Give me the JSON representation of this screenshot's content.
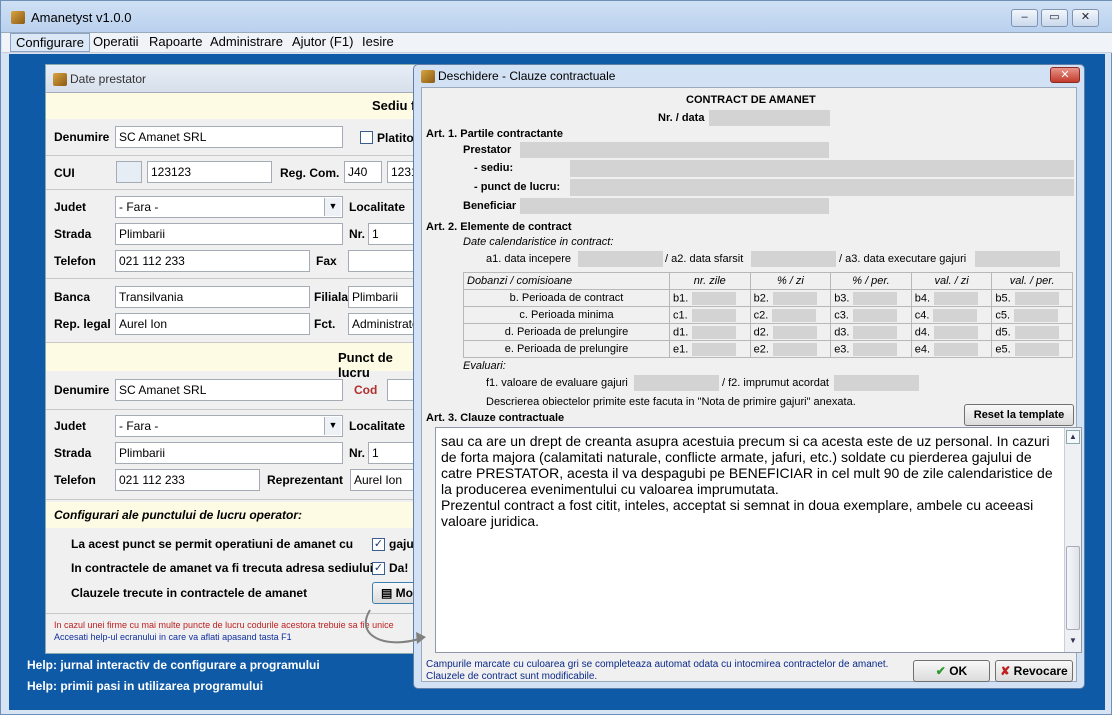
{
  "app": {
    "title": "Amanetyst v1.0.0",
    "controls": {
      "minimize": "‒",
      "maximize": "▭",
      "close": "✕"
    }
  },
  "menu": [
    "Configurare",
    "Operatii",
    "Rapoarte",
    "Administrare",
    "Ajutor (F1)",
    "Iesire"
  ],
  "help": [
    "Help: jurnal interactiv de configurare a programului",
    "Help: primii pasi in utilizarea programului"
  ],
  "prestator": {
    "title": "Date prestator",
    "sediu_header": "Sediu f",
    "denumire_label": "Denumire",
    "denumire": "SC Amanet SRL",
    "platitor_label": "Platitor",
    "cui_label": "CUI",
    "cui": "123123",
    "regcom_label": "Reg. Com.",
    "regcom_a": "J40",
    "regcom_b": "1231",
    "judet_label": "Judet",
    "judet": "- Fara -",
    "localitate_label": "Localitate",
    "strada_label": "Strada",
    "strada": "Plimbarii",
    "nr_label": "Nr.",
    "nr": "1",
    "telefon_label": "Telefon",
    "telefon": "021 112 233",
    "fax_label": "Fax",
    "banca_label": "Banca",
    "banca": "Transilvania",
    "filiala_label": "Filiala",
    "filiala": "Plimbarii",
    "rep_label": "Rep. legal",
    "rep": "Aurel Ion",
    "fct_label": "Fct.",
    "fct": "Administrator",
    "punct_header": "Punct de lucru",
    "p_denumire_label": "Denumire",
    "p_denumire": "SC Amanet SRL",
    "cod_label": "Cod",
    "p_judet_label": "Judet",
    "p_judet": "- Fara -",
    "p_localitate_label": "Localitate",
    "p_strada_label": "Strada",
    "p_strada": "Plimbarii",
    "p_nr_label": "Nr.",
    "p_nr": "1",
    "p_telefon_label": "Telefon",
    "p_telefon": "021 112 233",
    "reprezentant_label": "Reprezentant",
    "reprezentant": "Aurel Ion",
    "config_header": "Configurari ale punctului de lucru operator:",
    "opt1": "La acest punct se permit operatiuni de amanet cu",
    "opt1_val": "gajur",
    "opt2": "In contractele de amanet va fi trecuta adresa sediului",
    "opt2_val": "Da!",
    "opt3": "Clauzele trecute in contractele de amanet",
    "mod_button": "Mo",
    "note1": "In cazul unei firme cu mai multe puncte de lucru codurile acestora trebuie sa fie unice",
    "note2": "Accesati help-ul ecranului in care va aflati apasand tasta F1"
  },
  "dialog": {
    "title": "Deschidere - Clauze contractuale",
    "heading": "CONTRACT DE AMANET",
    "nr_data": "Nr. / data",
    "art1": "Art. 1. Partile contractante",
    "prestator": "Prestator",
    "sediu": "- sediu:",
    "punct": "- punct de lucru:",
    "beneficiar": "Beneficiar",
    "art2": "Art. 2. Elemente de contract",
    "date_cal": "Date calendaristice in contract:",
    "a1": "a1. data incepere",
    "a2": "/ a2. data sfarsit",
    "a3": "/ a3. data executare gajuri",
    "table": {
      "headers": [
        "Dobanzi / comisioane",
        "nr. zile",
        "% / zi",
        "% / per.",
        "val. / zi",
        "val. / per."
      ],
      "rows": [
        {
          "label": "b. Perioada de contract",
          "codes": [
            "b1.",
            "b2.",
            "b3.",
            "b4.",
            "b5."
          ]
        },
        {
          "label": "c. Perioada minima",
          "codes": [
            "c1.",
            "c2.",
            "c3.",
            "c4.",
            "c5."
          ]
        },
        {
          "label": "d. Perioada de prelungire",
          "codes": [
            "d1.",
            "d2.",
            "d3.",
            "d4.",
            "d5."
          ]
        },
        {
          "label": "e. Perioada de prelungire",
          "codes": [
            "e1.",
            "e2.",
            "e3.",
            "e4.",
            "e5."
          ]
        }
      ]
    },
    "evaluari": "Evaluari:",
    "f1": "f1. valoare de evaluare gajuri",
    "f2": "/ f2. imprumut acordat",
    "descriere": "Descrierea obiectelor primite este facuta in \"Nota de primire gajuri\" anexata.",
    "art3": "Art. 3. Clauze contractuale",
    "reset": "Reset la template",
    "clauze_text": "sau ca are un drept de creanta asupra acestuia precum si ca acesta este de uz personal. In cazuri de forta majora (calamitati naturale, conflicte armate, jafuri, etc.) soldate cu pierderea gajului de catre PRESTATOR, acesta il va despagubi pe BENEFICIAR in cel mult 90 de zile calendaristice de la producerea evenimentului cu valoarea imprumutata.\nPrezentul contract a fost citit, inteles, acceptat si semnat in doua exemplare, ambele cu aceeasi valoare juridica.",
    "note1": "Campurile marcate cu culoarea gri se completeaza automat odata cu intocmirea contractelor de amanet.",
    "note2": "Clauzele de contract sunt modificabile.",
    "ok": "OK",
    "cancel": "Revocare"
  }
}
